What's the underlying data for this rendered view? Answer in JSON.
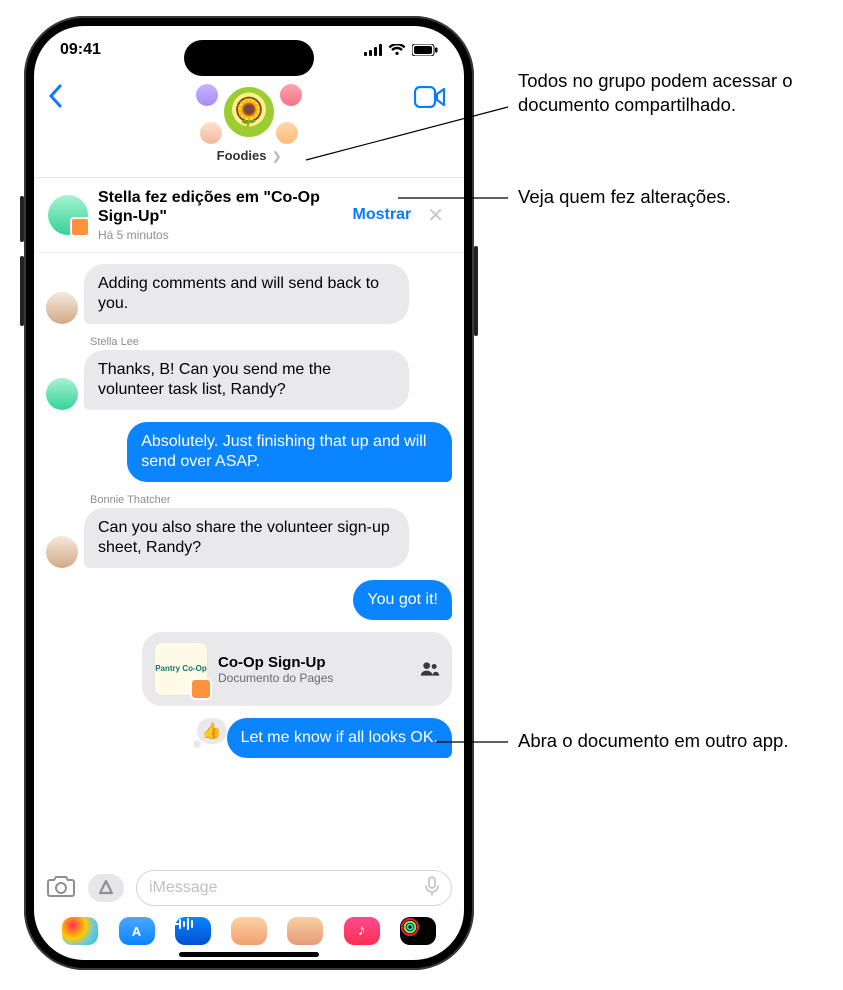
{
  "status_bar": {
    "time": "09:41"
  },
  "header": {
    "group_name": "Foodies"
  },
  "banner": {
    "title": "Stella fez edições em \"Co-Op Sign-Up\"",
    "subtitle": "Há 5 minutos",
    "action": "Mostrar"
  },
  "messages": [
    {
      "id": 0,
      "direction": "incoming",
      "sender": "",
      "text": "Adding comments and will send back to you."
    },
    {
      "id": 1,
      "direction": "incoming",
      "sender": "Stella Lee",
      "text": "Thanks, B! Can you send me the volunteer task list, Randy?"
    },
    {
      "id": 2,
      "direction": "outgoing",
      "text": "Absolutely. Just finishing that up and will send over ASAP."
    },
    {
      "id": 3,
      "direction": "incoming",
      "sender": "Bonnie Thatcher",
      "text": "Can you also share the volunteer sign-up sheet, Randy?"
    },
    {
      "id": 4,
      "direction": "outgoing",
      "text": "You got it!"
    },
    {
      "id": 5,
      "type": "document",
      "title": "Co-Op Sign-Up",
      "subtitle": "Documento do Pages",
      "thumb_text": "Pantry Co-Op"
    },
    {
      "id": 6,
      "direction": "outgoing",
      "text": "Let me know if all looks OK."
    }
  ],
  "input": {
    "placeholder": "iMessage"
  },
  "callouts": {
    "c1": "Todos no grupo podem acessar o documento compartilhado.",
    "c2": "Veja quem fez alterações.",
    "c3": "Abra o documento em outro app."
  }
}
